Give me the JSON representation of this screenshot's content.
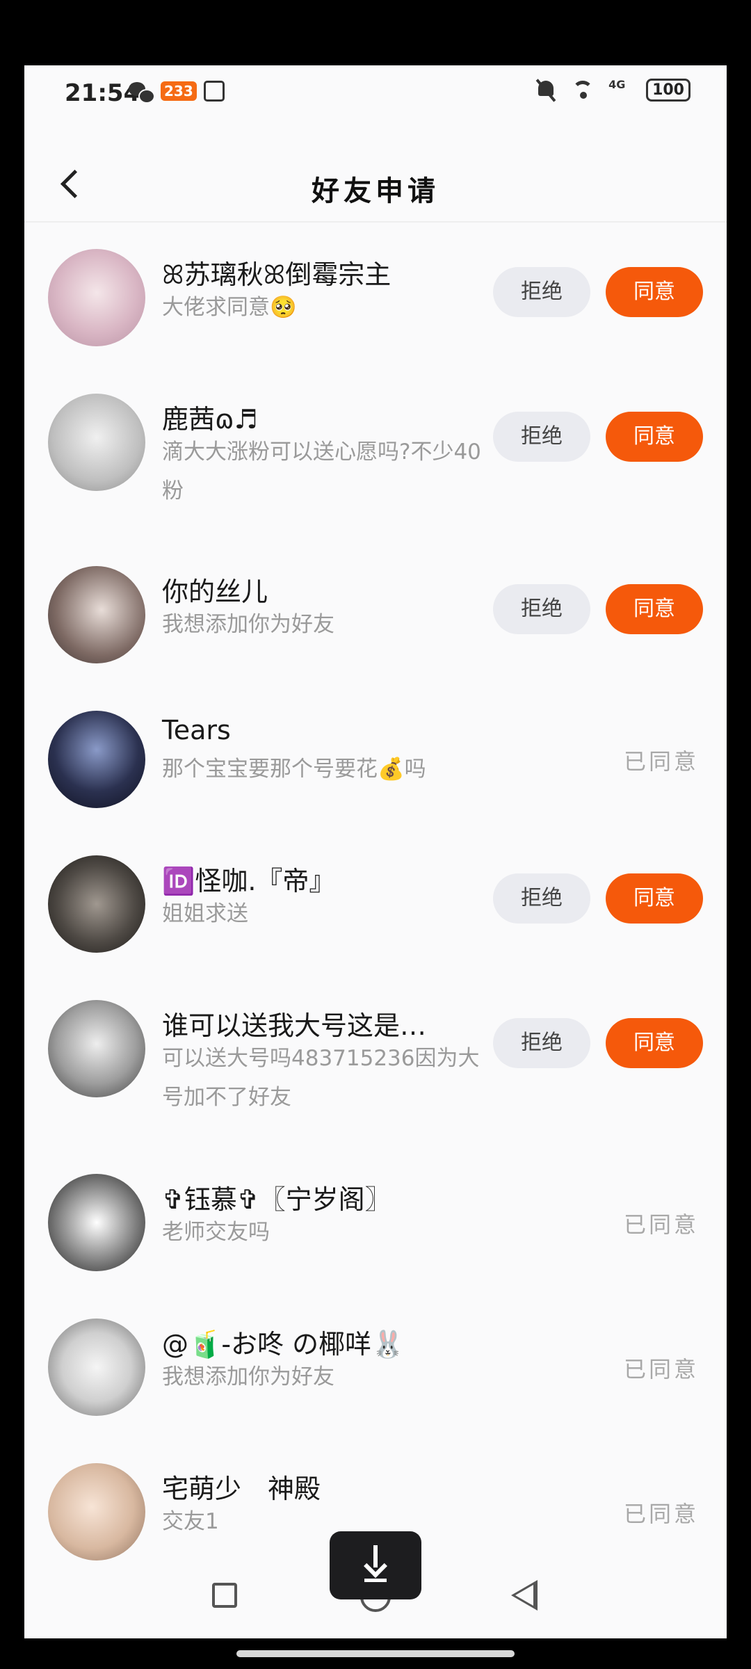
{
  "status_bar": {
    "time": "21:54",
    "badge": "233",
    "network": "4G",
    "battery": "100"
  },
  "header": {
    "title": "好友申请"
  },
  "actions": {
    "reject": "拒绝",
    "accept": "同意",
    "accepted": "已同意"
  },
  "requests": [
    {
      "name": "ꕤ苏璃秋ꕤ倒霉宗主",
      "message": "大佬求同意🥺",
      "status": "pending",
      "avatar_color": "#d9b6c4"
    },
    {
      "name": "鹿茜ɷ♬",
      "message": "滴大大涨粉可以送心愿吗?不少40粉",
      "status": "pending",
      "avatar_color": "#bfbfbf"
    },
    {
      "name": "你的丝儿",
      "message": "我想添加你为好友",
      "status": "pending",
      "avatar_color": "#7e6a64"
    },
    {
      "name": "Tears",
      "message": "那个宝宝要那个号要花💰吗",
      "status": "accepted",
      "avatar_color": "#2b3150"
    },
    {
      "name": "🆔怪咖.『帝』",
      "message": "姐姐求送",
      "status": "pending",
      "avatar_color": "#4f4a45"
    },
    {
      "name": "谁可以送我大号这是…",
      "message": "可以送大号吗483715236因为大号加不了好友",
      "status": "pending",
      "avatar_color": "#9d9d9d"
    },
    {
      "name": "✞钰慕✞〖宁岁阁〗",
      "message": "老师交友吗",
      "status": "accepted",
      "avatar_color": "#3a3a3a"
    },
    {
      "name": "@🧃-お咚 の椰咩🐰",
      "message": "我想添加你为好友",
      "status": "accepted",
      "avatar_color": "#cfcfcf"
    },
    {
      "name": "宅萌少　神殿",
      "message": "交友1",
      "status": "accepted",
      "avatar_color": "#d8b8a0"
    }
  ],
  "colors": {
    "accent": "#f5590b",
    "reject_bg": "#eaebf0",
    "secondary_text": "#9a9a9a"
  },
  "icons": {
    "back": "back-arrow-icon",
    "download": "download-icon",
    "nav": [
      "recents-square-icon",
      "home-circle-icon",
      "back-triangle-icon"
    ]
  }
}
